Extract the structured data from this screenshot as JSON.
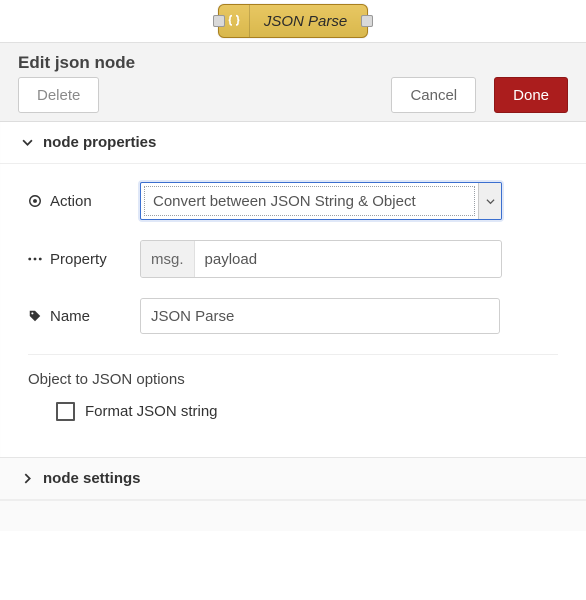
{
  "node": {
    "label": "JSON Parse"
  },
  "panel": {
    "title": "Edit json node",
    "buttons": {
      "delete": "Delete",
      "cancel": "Cancel",
      "done": "Done"
    },
    "sections": {
      "properties": "node properties",
      "settings": "node settings"
    }
  },
  "form": {
    "action": {
      "label": "Action",
      "value": "Convert between JSON String & Object"
    },
    "property": {
      "label": "Property",
      "prefix": "msg.",
      "value": "payload"
    },
    "name": {
      "label": "Name",
      "value": "JSON Parse"
    },
    "options_heading": "Object to JSON options",
    "format": {
      "label": "Format JSON string",
      "checked": false
    }
  }
}
